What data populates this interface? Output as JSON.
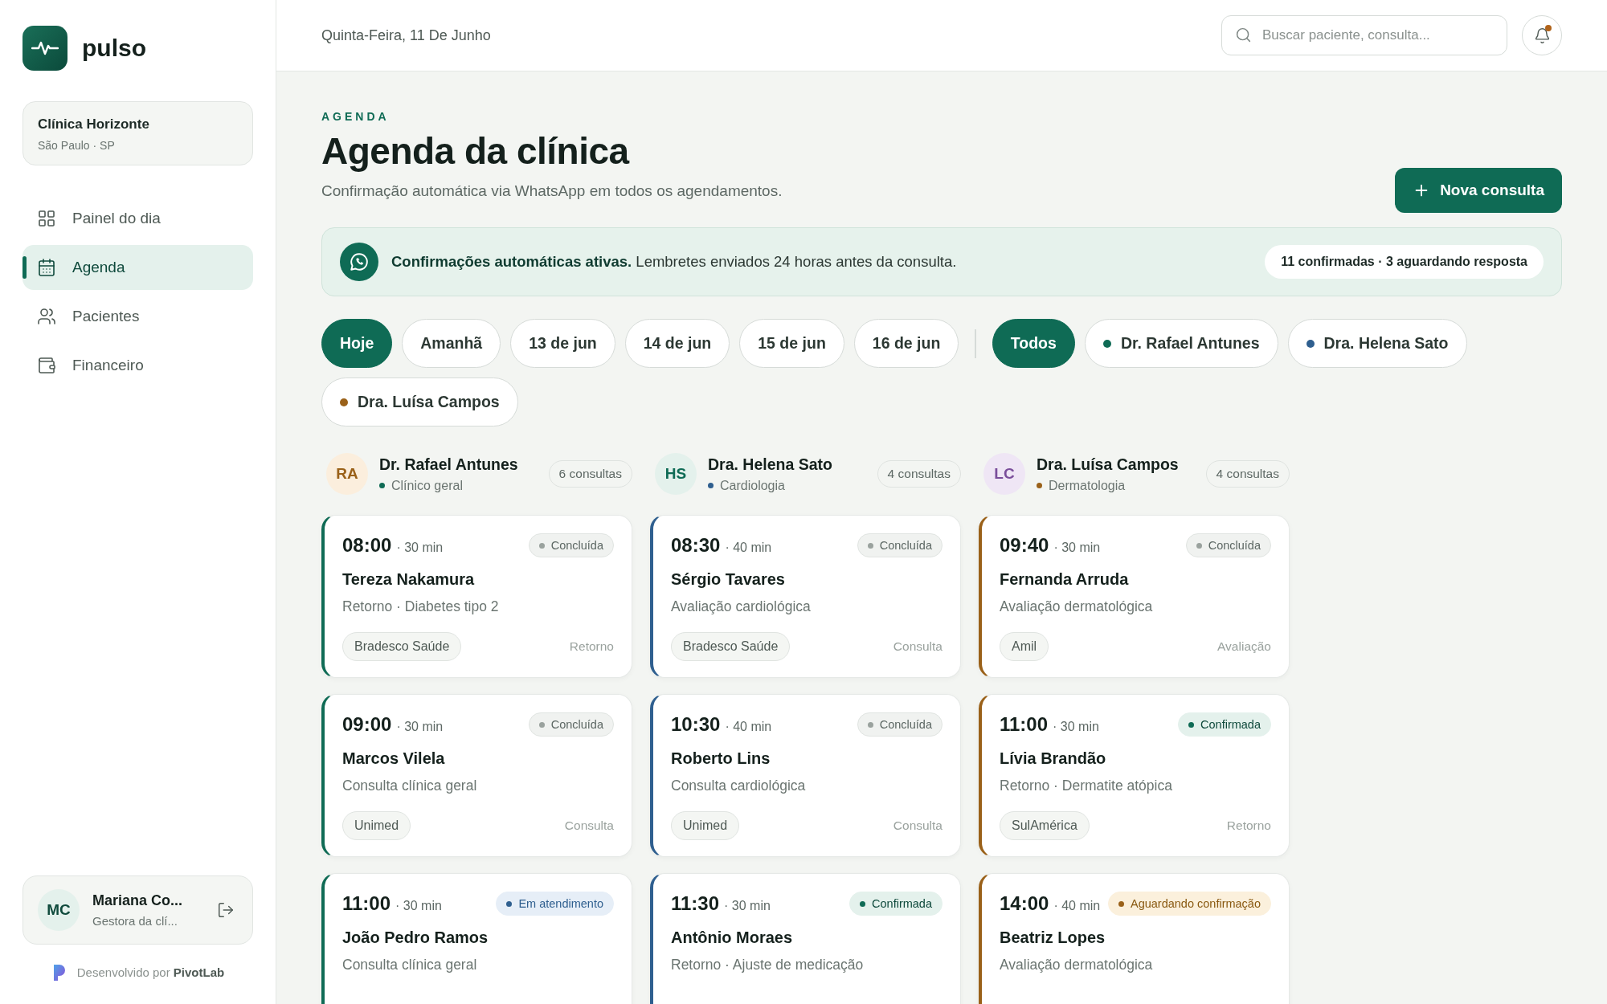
{
  "brand": {
    "name": "pulso"
  },
  "clinic": {
    "name": "Clínica Horizonte",
    "location": "São Paulo · SP"
  },
  "nav": [
    {
      "label": "Painel do dia",
      "kind": "dashboard",
      "selected": false
    },
    {
      "label": "Agenda",
      "kind": "calendar",
      "selected": true
    },
    {
      "label": "Pacientes",
      "kind": "users",
      "selected": false
    },
    {
      "label": "Financeiro",
      "kind": "wallet",
      "selected": false
    }
  ],
  "user": {
    "initials": "MC",
    "name": "Mariana Co...",
    "role": "Gestora da clí..."
  },
  "credit": {
    "text": "Desenvolvido por **PivotLab**"
  },
  "header": {
    "date": "Quinta-Feira, 11 De Junho",
    "search": {
      "placeholder": "Buscar paciente, consulta..."
    },
    "notifications": {
      "unread": true
    }
  },
  "page": {
    "eyebrow": "AGENDA",
    "title": "Agenda da clínica",
    "subtitle": "Confirmação automática via WhatsApp em todos os agendamentos.",
    "primary_button": "Nova consulta"
  },
  "banner": {
    "text": "**Confirmações automáticas ativas.** Lembretes enviados 24 horas antes da consulta.",
    "summary": "11 confirmadas · 3 aguardando resposta"
  },
  "date_filters": [
    {
      "label": "Hoje",
      "selected": true
    },
    {
      "label": "Amanhã",
      "selected": false
    },
    {
      "label": "13 de jun",
      "selected": false
    },
    {
      "label": "14 de jun",
      "selected": false
    },
    {
      "label": "15 de jun",
      "selected": false
    },
    {
      "label": "16 de jun",
      "selected": false
    }
  ],
  "doctor_filters": [
    {
      "label": "Todos",
      "selected": true
    },
    {
      "label": "Dr. Rafael Antunes",
      "selected": false,
      "color": "#0f6b55"
    },
    {
      "label": "Dra. Helena Sato",
      "selected": false,
      "color": "#2f5f8f"
    },
    {
      "label": "Dra. Luísa Campos",
      "selected": false,
      "color": "#9a6119"
    }
  ],
  "columns": [
    {
      "initials": "RA",
      "name": "Dr. Rafael Antunes",
      "specialty": "Clínico geral",
      "count": "6 consultas",
      "color": "#0f6b55",
      "appointments": [
        {
          "time": "08:00",
          "duration": "· 30 min",
          "status": "Concluída",
          "kind": "done",
          "patient": "Tereza Nakamura",
          "description": "Retorno · Diabetes tipo 2",
          "insurance": "Bradesco Saúde",
          "type": "Retorno"
        },
        {
          "time": "09:00",
          "duration": "· 30 min",
          "status": "Concluída",
          "kind": "done",
          "patient": "Marcos Vilela",
          "description": "Consulta clínica geral",
          "insurance": "Unimed",
          "type": "Consulta"
        },
        {
          "time": "11:00",
          "duration": "· 30 min",
          "status": "Em atendimento",
          "kind": "in_progress",
          "patient": "João Pedro Ramos",
          "description": "Consulta clínica geral"
        }
      ]
    },
    {
      "initials": "HS",
      "name": "Dra. Helena Sato",
      "specialty": "Cardiologia",
      "count": "4 consultas",
      "color": "#2f5f8f",
      "appointments": [
        {
          "time": "08:30",
          "duration": "· 40 min",
          "status": "Concluída",
          "kind": "done",
          "patient": "Sérgio Tavares",
          "description": "Avaliação cardiológica",
          "insurance": "Bradesco Saúde",
          "type": "Consulta"
        },
        {
          "time": "10:30",
          "duration": "· 40 min",
          "status": "Concluída",
          "kind": "done",
          "patient": "Roberto Lins",
          "description": "Consulta cardiológica",
          "insurance": "Unimed",
          "type": "Consulta"
        },
        {
          "time": "11:30",
          "duration": "· 30 min",
          "status": "Confirmada",
          "kind": "confirmed",
          "patient": "Antônio Moraes",
          "description": "Retorno · Ajuste de medicação"
        }
      ]
    },
    {
      "initials": "LC",
      "name": "Dra. Luísa Campos",
      "specialty": "Dermatologia",
      "count": "4 consultas",
      "color": "#9a6119",
      "appointments": [
        {
          "time": "09:40",
          "duration": "· 30 min",
          "status": "Concluída",
          "kind": "done",
          "patient": "Fernanda Arruda",
          "description": "Avaliação dermatológica",
          "insurance": "Amil",
          "type": "Avaliação"
        },
        {
          "time": "11:00",
          "duration": "· 30 min",
          "status": "Confirmada",
          "kind": "confirmed",
          "patient": "Lívia Brandão",
          "description": "Retorno · Dermatite atópica",
          "insurance": "SulAmérica",
          "type": "Retorno"
        },
        {
          "time": "14:00",
          "duration": "· 40 min",
          "status": "Aguardando confirmação",
          "kind": "awaiting",
          "patient": "Beatriz Lopes",
          "description": "Avaliação dermatológica"
        }
      ]
    }
  ]
}
